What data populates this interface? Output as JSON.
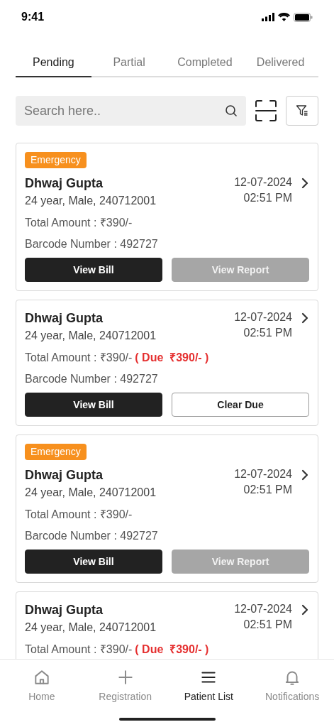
{
  "status_bar": {
    "time": "9:41"
  },
  "tabs": [
    {
      "label": "Pending",
      "selected": true
    },
    {
      "label": "Partial",
      "selected": false
    },
    {
      "label": "Completed",
      "selected": false
    },
    {
      "label": "Delivered",
      "selected": false
    }
  ],
  "search": {
    "placeholder": "Search here.."
  },
  "patients": [
    {
      "badge": "Emergency",
      "name": "Dhwaj Gupta",
      "info": "24 year, Male, 240712001",
      "date": "12-07-2024",
      "time": "02:51 PM",
      "amount": "Total Amount : ₹390/-",
      "barcode": "Barcode Number : 492727",
      "buttons": [
        {
          "label": "View Bill",
          "kind": "primary"
        },
        {
          "label": "View Report",
          "kind": "disabled"
        }
      ]
    },
    {
      "name": "Dhwaj Gupta",
      "info": "24 year, Male, 240712001",
      "date": "12-07-2024",
      "time": "02:51 PM",
      "amount": "Total Amount : ₹390/-",
      "due": "( Due  ₹390/- )",
      "barcode": "Barcode Number : 492727",
      "buttons": [
        {
          "label": "View Bill",
          "kind": "primary"
        },
        {
          "label": "Clear Due",
          "kind": "outline"
        }
      ]
    },
    {
      "badge": "Emergency",
      "name": "Dhwaj Gupta",
      "info": "24 year, Male, 240712001",
      "date": "12-07-2024",
      "time": "02:51 PM",
      "amount": "Total Amount : ₹390/-",
      "barcode": "Barcode Number : 492727",
      "buttons": [
        {
          "label": "View Bill",
          "kind": "primary"
        },
        {
          "label": "View Report",
          "kind": "disabled"
        }
      ]
    },
    {
      "name": "Dhwaj Gupta",
      "info": "24 year, Male, 240712001",
      "date": "12-07-2024",
      "time": "02:51 PM",
      "amount": "Total Amount : ₹390/-",
      "due": "( Due  ₹390/- )"
    }
  ],
  "bottom_nav": [
    {
      "label": "Home",
      "kind": "home",
      "selected": false
    },
    {
      "label": "Registration",
      "kind": "add",
      "selected": false
    },
    {
      "label": "Patient List",
      "kind": "list",
      "selected": true
    },
    {
      "label": "Notifications",
      "kind": "bell",
      "selected": false
    }
  ]
}
